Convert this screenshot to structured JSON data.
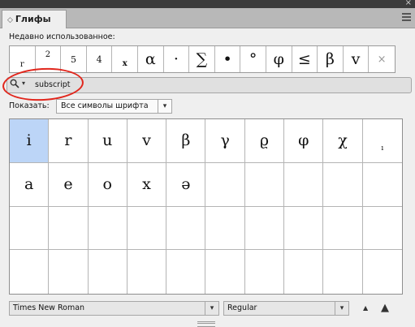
{
  "panel": {
    "tab_title": "Глифы",
    "tab_glyph": "◇",
    "close_glyph": "×"
  },
  "recent": {
    "label": "Недавно использованное:",
    "glyphs": [
      "r",
      "2",
      "5",
      "4",
      "x",
      "α",
      "·",
      "∑",
      "•",
      "°",
      "φ",
      "≤",
      "β",
      "v",
      "×"
    ]
  },
  "search": {
    "icon_glyph": "🔍",
    "chevron_glyph": "▾",
    "value": "subscript"
  },
  "show": {
    "label": "Показать:",
    "selected": "Все символы шрифта",
    "arrow": "▾"
  },
  "glyph_grid": {
    "row1": [
      "i",
      "r",
      "u",
      "v",
      "β",
      "γ",
      "ϱ",
      "φ",
      "χ",
      "ı"
    ],
    "row2": [
      "a",
      "e",
      "o",
      "x",
      "ə"
    ]
  },
  "font": {
    "family": "Times New Roman",
    "style": "Regular",
    "arrow": "▾"
  },
  "zoom": {
    "out_glyph": "▲",
    "in_glyph": "▲"
  },
  "annotation_color": "#e1261c",
  "selection_color": "#bcd5f7"
}
